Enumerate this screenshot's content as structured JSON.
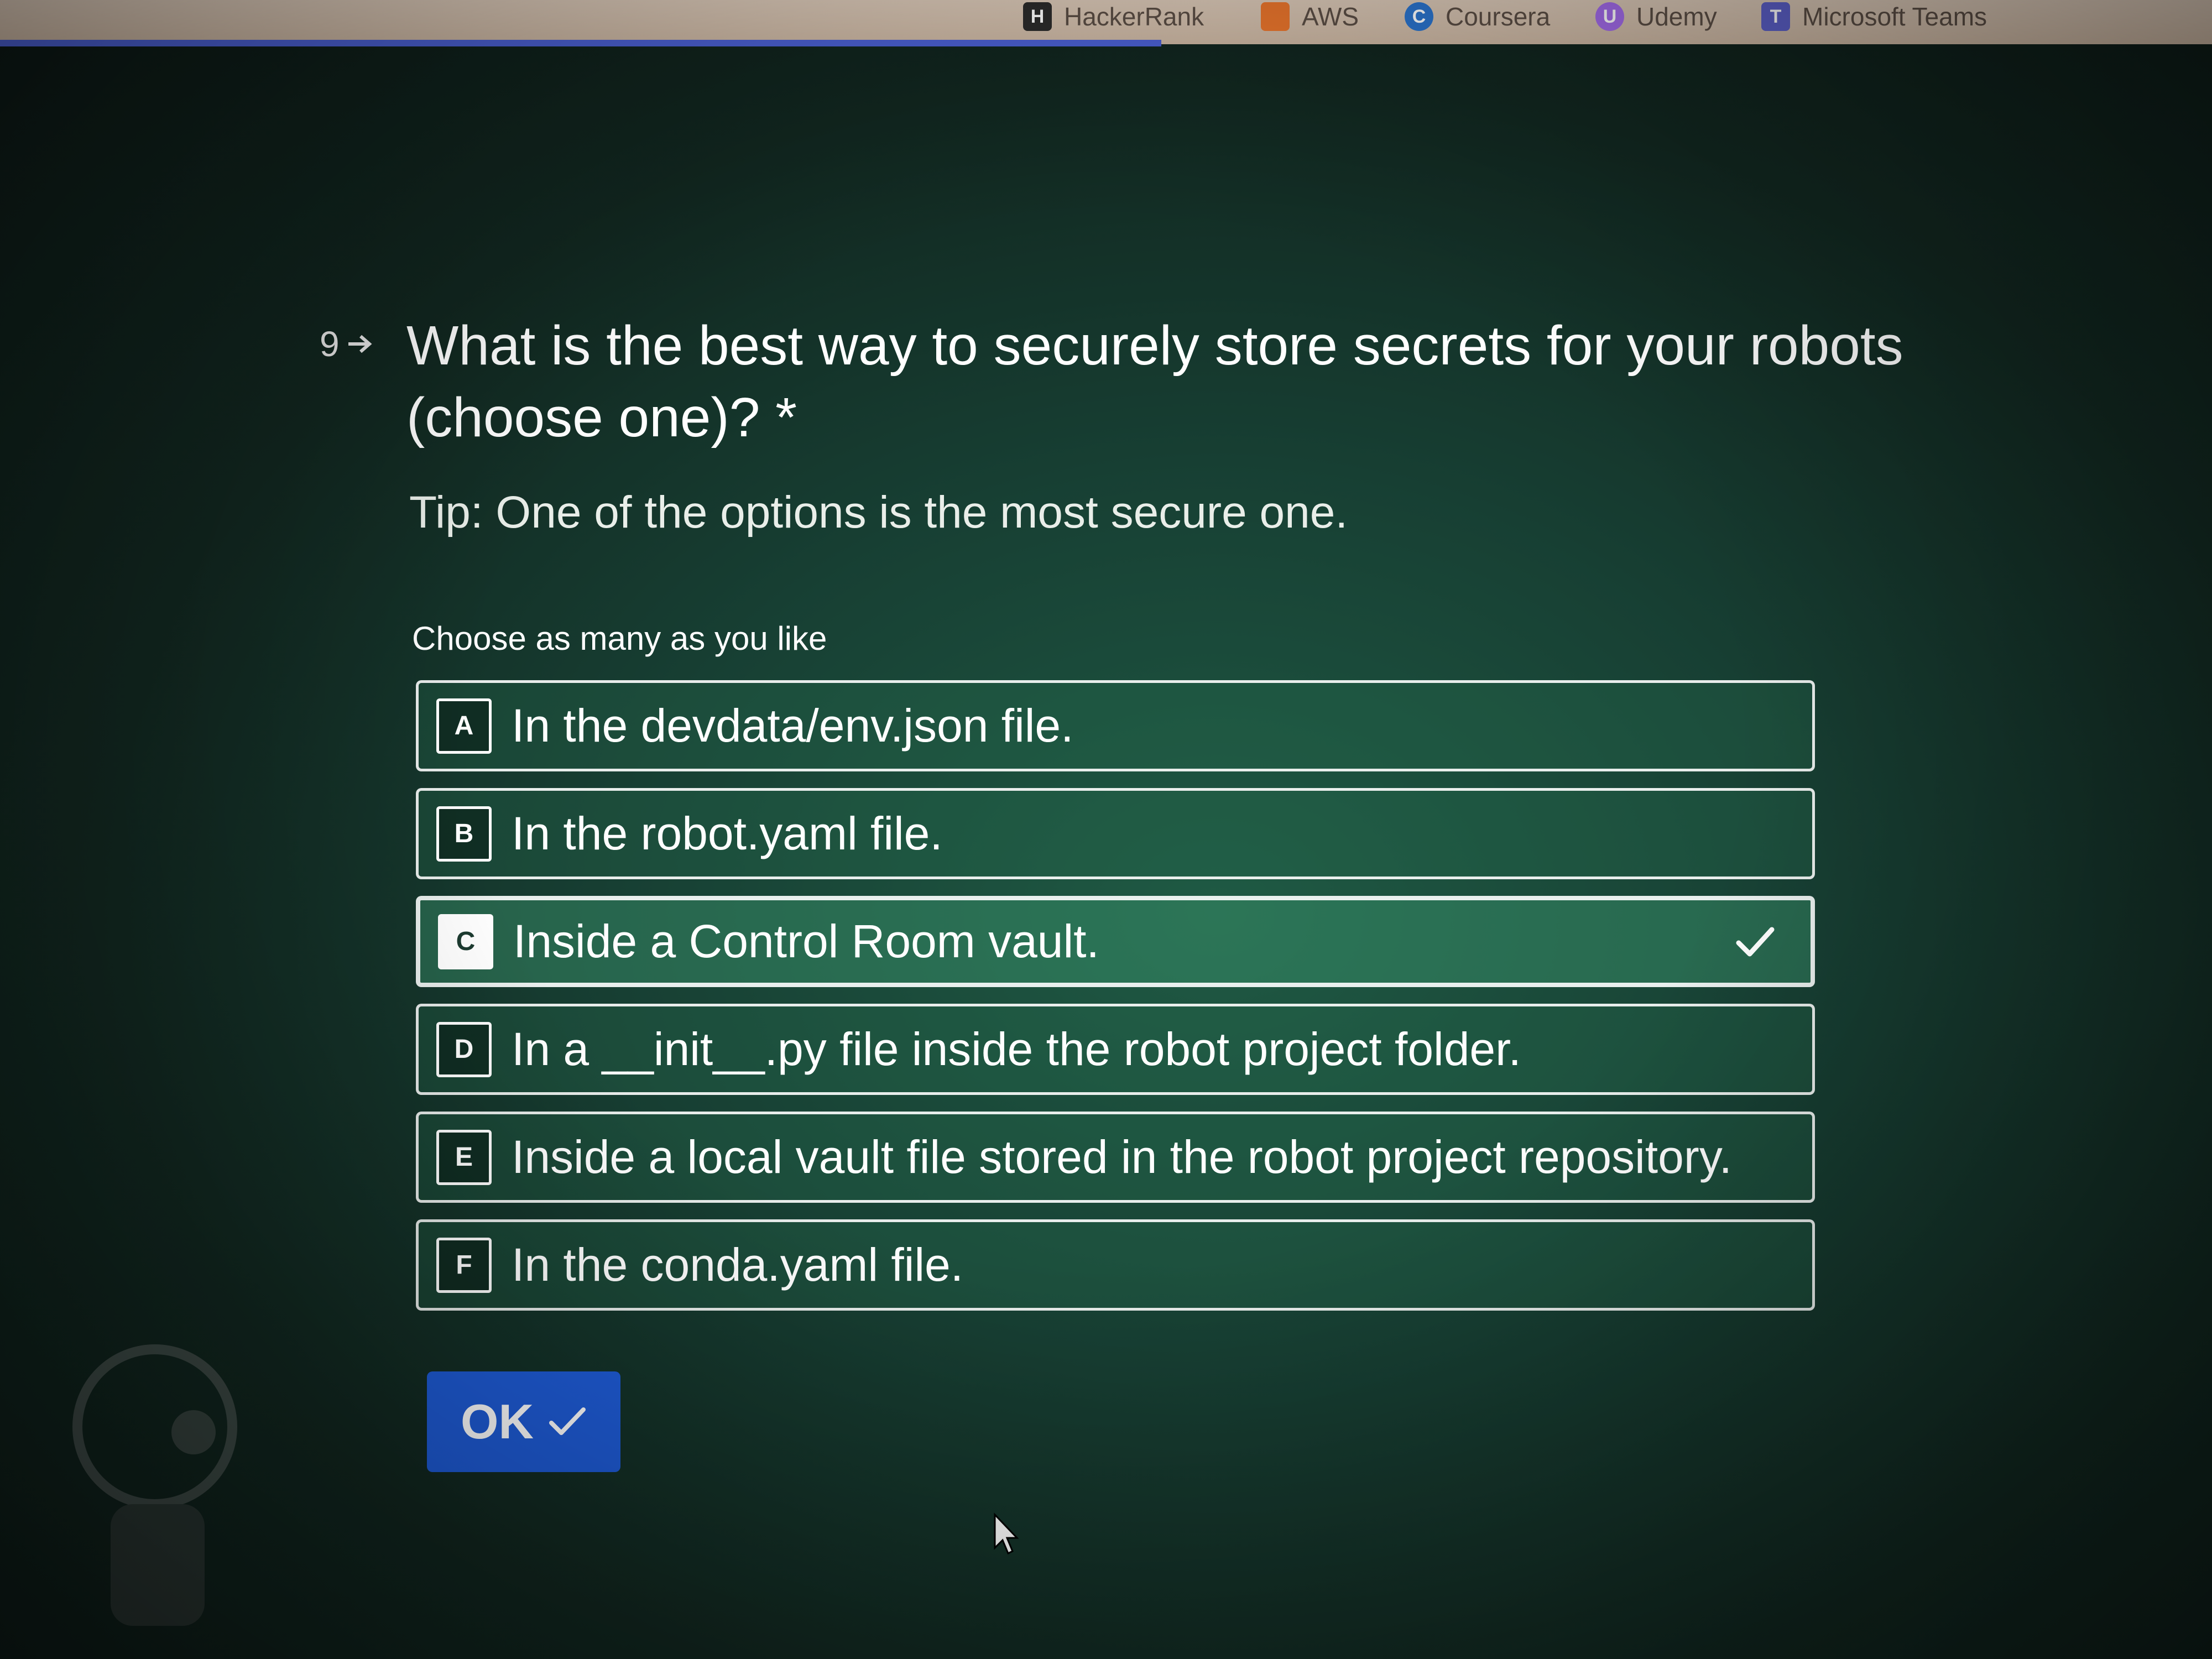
{
  "bookmarks": [
    {
      "label": "HackerRank",
      "icon": "hackerrank-icon",
      "color": "#2b2b2b"
    },
    {
      "label": "AWS",
      "icon": "aws-icon",
      "color": "#e8742c"
    },
    {
      "label": "Coursera",
      "icon": "coursera-icon",
      "color": "#2a73cc"
    },
    {
      "label": "Udemy",
      "icon": "udemy-icon",
      "color": "#a16ae8"
    },
    {
      "label": "Microsoft Teams",
      "icon": "teams-icon",
      "color": "#5b5fc7"
    }
  ],
  "question": {
    "number": "9",
    "title": "What is the best way to securely store secrets for your robots (choose one)? *",
    "tip": "Tip: One of the options is the most secure one.",
    "hint": "Choose as many as you like"
  },
  "options": [
    {
      "key": "A",
      "label": "In the devdata/env.json file.",
      "selected": false
    },
    {
      "key": "B",
      "label": "In the robot.yaml file.",
      "selected": false
    },
    {
      "key": "C",
      "label": "Inside a Control Room vault.",
      "selected": true
    },
    {
      "key": "D",
      "label": "In a __init__.py file inside the robot project folder.",
      "selected": false
    },
    {
      "key": "E",
      "label": "Inside a local vault file stored in the robot project repository.",
      "selected": false
    },
    {
      "key": "F",
      "label": "In the conda.yaml file.",
      "selected": false
    }
  ],
  "ok_button": {
    "label": "OK",
    "color": "#1e5bd6"
  },
  "colors": {
    "accent": "#1e5bd6",
    "background": "#173f33"
  }
}
